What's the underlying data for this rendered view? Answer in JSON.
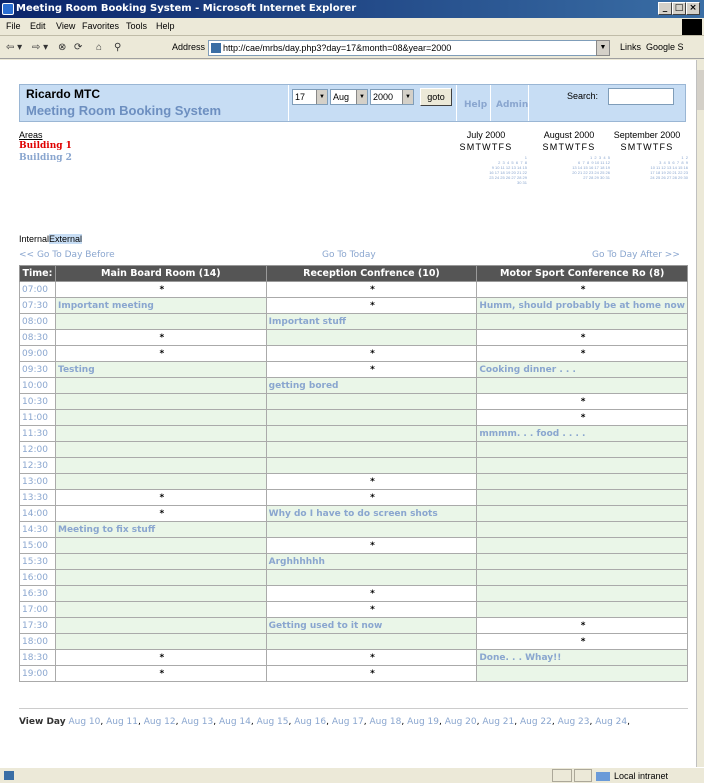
{
  "window": {
    "title": "Meeting Room Booking System - Microsoft Internet Explorer",
    "menu": [
      "File",
      "Edit",
      "View",
      "Favorites",
      "Tools",
      "Help"
    ],
    "address_label": "Address",
    "url": "http://cae/mrbs/day.php3?day=17&month=08&year=2000",
    "links_label": "Links",
    "google_label": "Google S",
    "status_zone": "Local intranet"
  },
  "header": {
    "org": "Ricardo MTC",
    "system": "Meeting Room Booking System",
    "day": "17",
    "month": "Aug",
    "year": "2000",
    "goto": "goto",
    "help": "Help",
    "admin": "Admin",
    "search_label": "Search:"
  },
  "areas": {
    "label": "Areas",
    "building1": "Building 1",
    "building2": "Building 2"
  },
  "calendars": [
    {
      "title": "July 2000",
      "days": "SMTWTFS",
      "weeks": "              1\n 2  3  4  5  6  7  8\n 9 10 11 12 13 14 15\n16 17 18 19 20 21 22\n23 24 25 26 27 28 29\n30 31"
    },
    {
      "title": "August 2000",
      "days": "SMTWTFS",
      "weeks": "      1  2  3  4  5\n 6  7  8  9 10 11 12\n13 14 15 16 17 18 19\n20 21 22 23 24 25 26\n27 28 29 30 31"
    },
    {
      "title": "September 2000",
      "days": "SMTWTFS",
      "weeks": "                 1  2\n 3  4  5  6  7  8  9\n10 11 12 13 14 15 16\n17 18 19 20 21 22 23\n24 25 26 27 28 29 30"
    }
  ],
  "legend": {
    "internal": "Internal",
    "external": "External"
  },
  "nav": {
    "before": "<< Go To Day Before",
    "today": "Go To Today",
    "after": "Go To Day After >>"
  },
  "grid": {
    "headers": [
      "Time:",
      "Main Board Room (14)",
      "Reception Confrence (10)",
      "Motor Sport Conference Ro (8)"
    ],
    "rows": [
      {
        "time": "07:00",
        "c": [
          "*",
          "*",
          "*"
        ]
      },
      {
        "time": "07:30",
        "c": [
          "Important meeting",
          "*",
          "Humm, should probably be at home now"
        ]
      },
      {
        "time": "08:00",
        "c": [
          "",
          "Important stuff",
          ""
        ]
      },
      {
        "time": "08:30",
        "c": [
          "*",
          "",
          "*"
        ]
      },
      {
        "time": "09:00",
        "c": [
          "*",
          "*",
          "*"
        ]
      },
      {
        "time": "09:30",
        "c": [
          "Testing",
          "*",
          "Cooking dinner . . ."
        ]
      },
      {
        "time": "10:00",
        "c": [
          "",
          "getting bored",
          ""
        ]
      },
      {
        "time": "10:30",
        "c": [
          "",
          "",
          "*"
        ]
      },
      {
        "time": "11:00",
        "c": [
          "",
          "",
          "*"
        ]
      },
      {
        "time": "11:30",
        "c": [
          "",
          "",
          "mmmm. . . food . . . ."
        ]
      },
      {
        "time": "12:00",
        "c": [
          "",
          "",
          ""
        ]
      },
      {
        "time": "12:30",
        "c": [
          "",
          "",
          ""
        ]
      },
      {
        "time": "13:00",
        "c": [
          "",
          "*",
          ""
        ]
      },
      {
        "time": "13:30",
        "c": [
          "*",
          "*",
          ""
        ]
      },
      {
        "time": "14:00",
        "c": [
          "*",
          "Why do I have to do screen shots",
          ""
        ]
      },
      {
        "time": "14:30",
        "c": [
          "Meeting to fix stuff",
          "",
          ""
        ]
      },
      {
        "time": "15:00",
        "c": [
          "",
          "*",
          ""
        ]
      },
      {
        "time": "15:30",
        "c": [
          "",
          "Arghhhhhh",
          ""
        ]
      },
      {
        "time": "16:00",
        "c": [
          "",
          "",
          ""
        ]
      },
      {
        "time": "16:30",
        "c": [
          "",
          "*",
          ""
        ]
      },
      {
        "time": "17:00",
        "c": [
          "",
          "*",
          ""
        ]
      },
      {
        "time": "17:30",
        "c": [
          "",
          "Getting used to it now",
          "*"
        ]
      },
      {
        "time": "18:00",
        "c": [
          "",
          "",
          "*"
        ]
      },
      {
        "time": "18:30",
        "c": [
          "*",
          "*",
          "Done. . . Whay!!"
        ]
      },
      {
        "time": "19:00",
        "c": [
          "*",
          "*",
          ""
        ]
      }
    ]
  },
  "viewday": {
    "label": "View Day",
    "days": [
      "Aug 10",
      "Aug 11",
      "Aug 12",
      "Aug 13",
      "Aug 14",
      "Aug 15",
      "Aug 16",
      "Aug 17",
      "Aug 18",
      "Aug 19",
      "Aug 20",
      "Aug 21",
      "Aug 22",
      "Aug 23",
      "Aug 24"
    ]
  }
}
